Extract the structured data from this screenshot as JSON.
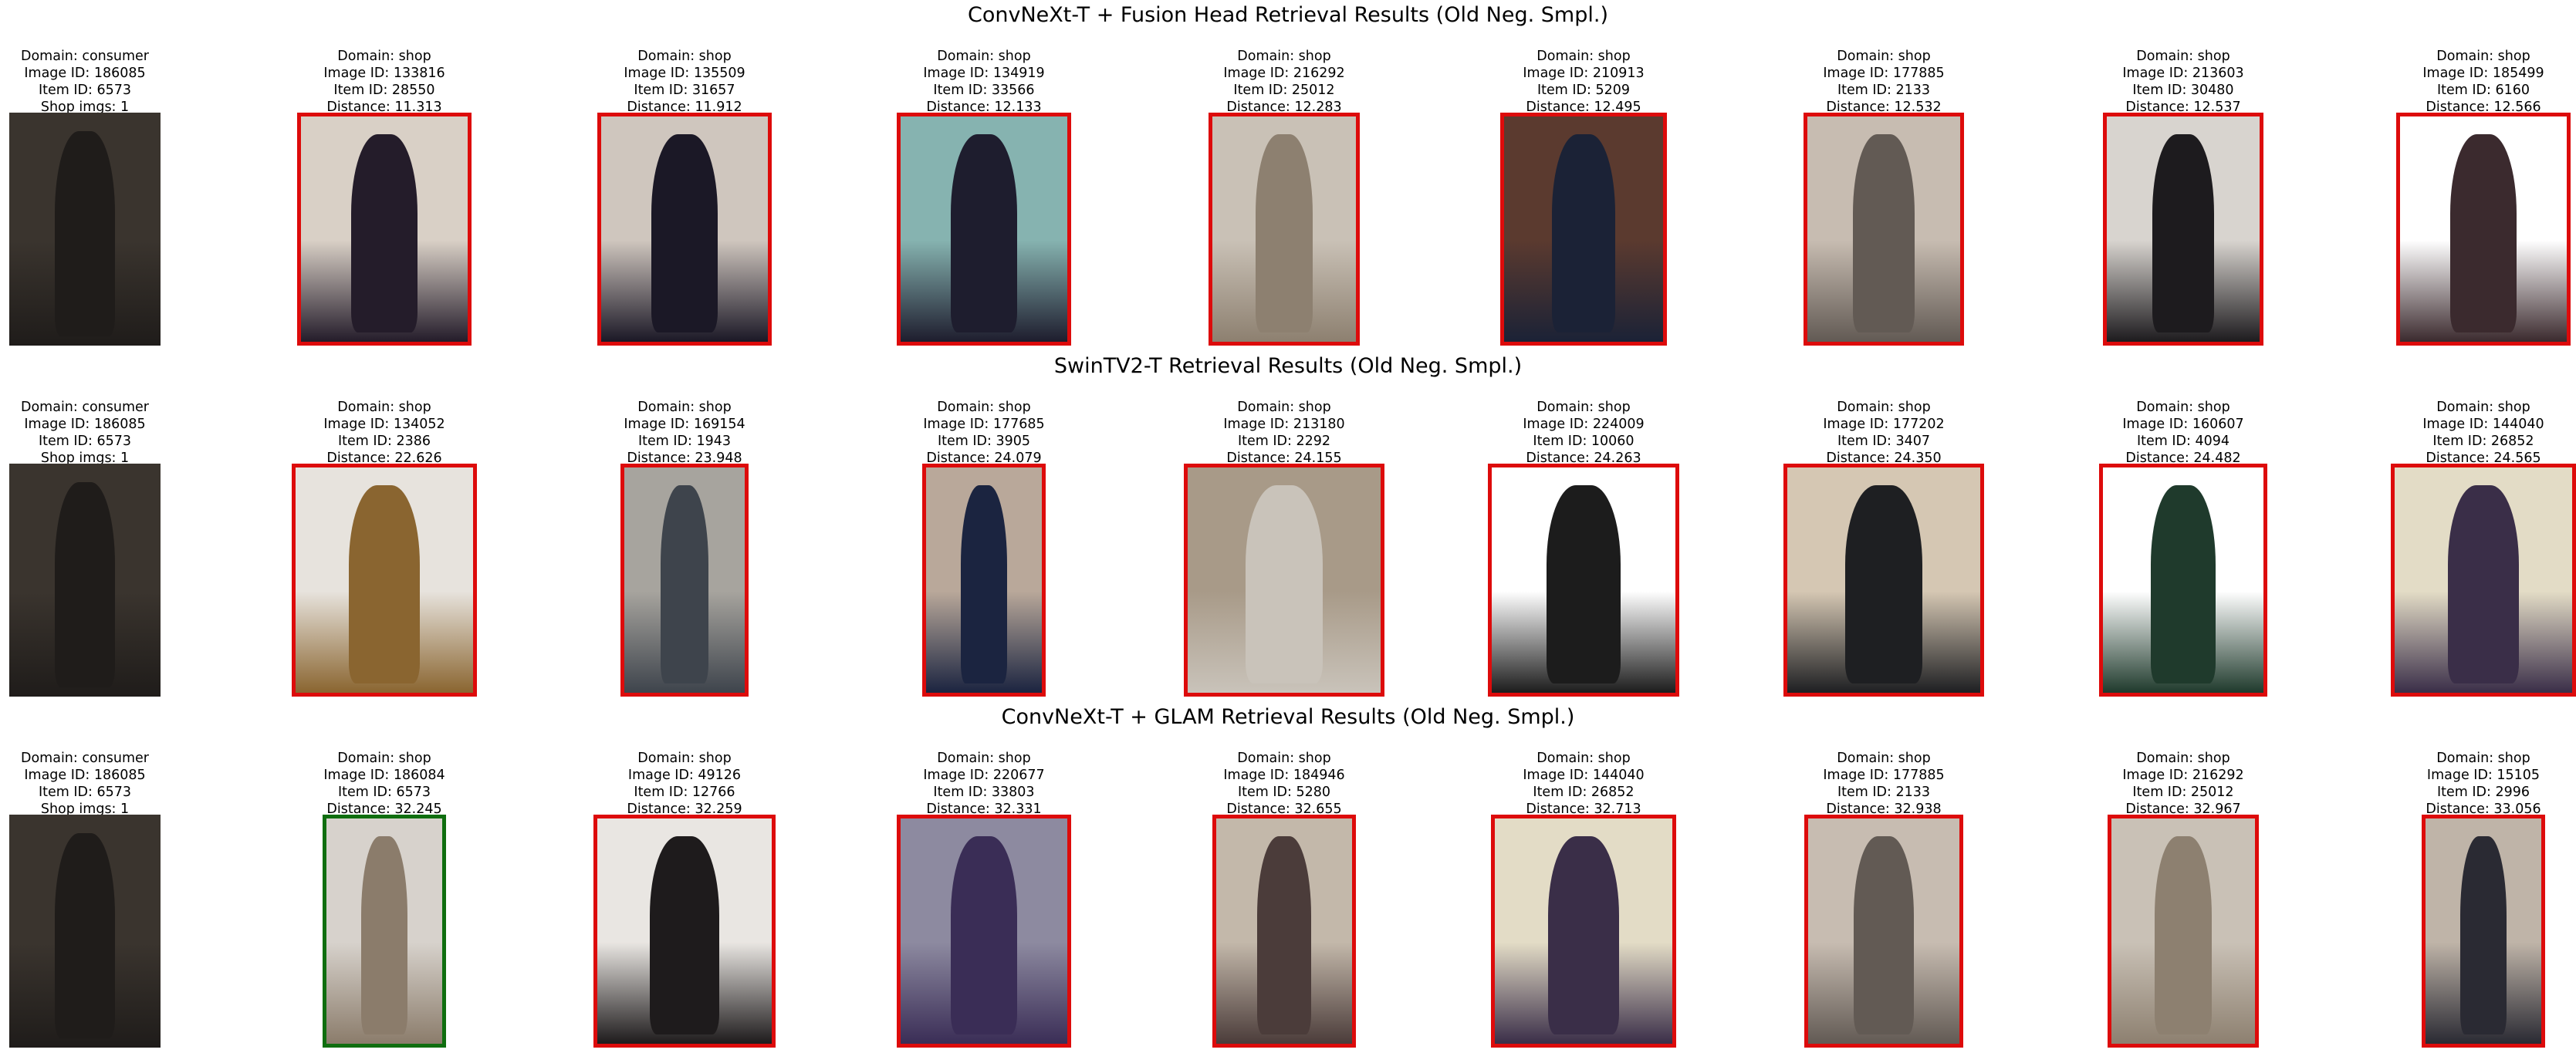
{
  "rows": [
    {
      "title": "ConvNeXt-T + Fusion Head Retrieval Results (Old Neg. Smpl.)",
      "query": {
        "domain": "Domain: consumer",
        "image_id": "Image ID: 186085",
        "item_id": "Item ID: 6573",
        "extra": "Shop imgs: 1",
        "colors": [
          "#3a342e",
          "#1f1c1a"
        ]
      },
      "results": [
        {
          "domain": "Domain: shop",
          "image_id": "Image ID: 133816",
          "item_id": "Item ID: 28550",
          "extra": "Distance: 11.313",
          "match": false,
          "colors": [
            "#d9d0c6",
            "#241c2a"
          ]
        },
        {
          "domain": "Domain: shop",
          "image_id": "Image ID: 135509",
          "item_id": "Item ID: 31657",
          "extra": "Distance: 11.912",
          "match": false,
          "colors": [
            "#cfc6be",
            "#1b1826"
          ]
        },
        {
          "domain": "Domain: shop",
          "image_id": "Image ID: 134919",
          "item_id": "Item ID: 33566",
          "extra": "Distance: 12.133",
          "match": false,
          "colors": [
            "#86b3b0",
            "#1e1d2e"
          ]
        },
        {
          "domain": "Domain: shop",
          "image_id": "Image ID: 216292",
          "item_id": "Item ID: 25012",
          "extra": "Distance: 12.283",
          "match": false,
          "colors": [
            "#c9c1b6",
            "#8d8070"
          ]
        },
        {
          "domain": "Domain: shop",
          "image_id": "Image ID: 210913",
          "item_id": "Item ID: 5209",
          "extra": "Distance: 12.495",
          "match": false,
          "colors": [
            "#5b3a2f",
            "#1b2236"
          ]
        },
        {
          "domain": "Domain: shop",
          "image_id": "Image ID: 177885",
          "item_id": "Item ID: 2133",
          "extra": "Distance: 12.532",
          "match": false,
          "colors": [
            "#c7bcb1",
            "#625a54"
          ]
        },
        {
          "domain": "Domain: shop",
          "image_id": "Image ID: 213603",
          "item_id": "Item ID: 30480",
          "extra": "Distance: 12.537",
          "match": false,
          "colors": [
            "#d8d4cf",
            "#1d1b1e"
          ]
        },
        {
          "domain": "Domain: shop",
          "image_id": "Image ID: 185499",
          "item_id": "Item ID: 6160",
          "extra": "Distance: 12.566",
          "match": false,
          "colors": [
            "#ffffff",
            "#3b2a2e"
          ]
        }
      ]
    },
    {
      "title": "SwinTV2-T Retrieval Results (Old Neg. Smpl.)",
      "query": {
        "domain": "Domain: consumer",
        "image_id": "Image ID: 186085",
        "item_id": "Item ID: 6573",
        "extra": "Shop imgs: 1",
        "colors": [
          "#3a342e",
          "#1f1c1a"
        ]
      },
      "results": [
        {
          "domain": "Domain: shop",
          "image_id": "Image ID: 134052",
          "item_id": "Item ID: 2386",
          "extra": "Distance: 22.626",
          "match": false,
          "colors": [
            "#e7e3dd",
            "#8a6530"
          ]
        },
        {
          "domain": "Domain: shop",
          "image_id": "Image ID: 169154",
          "item_id": "Item ID: 1943",
          "extra": "Distance: 23.948",
          "match": false,
          "colors": [
            "#a7a49e",
            "#3e444c"
          ]
        },
        {
          "domain": "Domain: shop",
          "image_id": "Image ID: 177685",
          "item_id": "Item ID: 3905",
          "extra": "Distance: 24.079",
          "match": false,
          "colors": [
            "#b9a89a",
            "#1b2440"
          ]
        },
        {
          "domain": "Domain: shop",
          "image_id": "Image ID: 213180",
          "item_id": "Item ID: 2292",
          "extra": "Distance: 24.155",
          "match": false,
          "colors": [
            "#a89a88",
            "#c9c3ba"
          ]
        },
        {
          "domain": "Domain: shop",
          "image_id": "Image ID: 224009",
          "item_id": "Item ID: 10060",
          "extra": "Distance: 24.263",
          "match": false,
          "colors": [
            "#ffffff",
            "#1c1c1c"
          ]
        },
        {
          "domain": "Domain: shop",
          "image_id": "Image ID: 177202",
          "item_id": "Item ID: 3407",
          "extra": "Distance: 24.350",
          "match": false,
          "colors": [
            "#d5c7b3",
            "#1e1f22"
          ]
        },
        {
          "domain": "Domain: shop",
          "image_id": "Image ID: 160607",
          "item_id": "Item ID: 4094",
          "extra": "Distance: 24.482",
          "match": false,
          "colors": [
            "#ffffff",
            "#1f3a2c"
          ]
        },
        {
          "domain": "Domain: shop",
          "image_id": "Image ID: 144040",
          "item_id": "Item ID: 26852",
          "extra": "Distance: 24.565",
          "match": false,
          "colors": [
            "#e3dcc6",
            "#3a2e48"
          ]
        }
      ]
    },
    {
      "title": "ConvNeXt-T + GLAM Retrieval Results (Old Neg. Smpl.)",
      "query": {
        "domain": "Domain: consumer",
        "image_id": "Image ID: 186085",
        "item_id": "Item ID: 6573",
        "extra": "Shop imgs: 1",
        "colors": [
          "#3a342e",
          "#1f1c1a"
        ]
      },
      "results": [
        {
          "domain": "Domain: shop",
          "image_id": "Image ID: 186084",
          "item_id": "Item ID: 6573",
          "extra": "Distance: 32.245",
          "match": true,
          "colors": [
            "#d7d2cc",
            "#8b7c6b"
          ]
        },
        {
          "domain": "Domain: shop",
          "image_id": "Image ID: 49126",
          "item_id": "Item ID: 12766",
          "extra": "Distance: 32.259",
          "match": false,
          "colors": [
            "#e9e6e2",
            "#1e1b1c"
          ]
        },
        {
          "domain": "Domain: shop",
          "image_id": "Image ID: 220677",
          "item_id": "Item ID: 33803",
          "extra": "Distance: 32.331",
          "match": false,
          "colors": [
            "#8d8aa0",
            "#3a2d56"
          ]
        },
        {
          "domain": "Domain: shop",
          "image_id": "Image ID: 184946",
          "item_id": "Item ID: 5280",
          "extra": "Distance: 32.655",
          "match": false,
          "colors": [
            "#c3b8aa",
            "#4b3c3a"
          ]
        },
        {
          "domain": "Domain: shop",
          "image_id": "Image ID: 144040",
          "item_id": "Item ID: 26852",
          "extra": "Distance: 32.713",
          "match": false,
          "colors": [
            "#e3dcc6",
            "#3a2e48"
          ]
        },
        {
          "domain": "Domain: shop",
          "image_id": "Image ID: 177885",
          "item_id": "Item ID: 2133",
          "extra": "Distance: 32.938",
          "match": false,
          "colors": [
            "#c7bcb1",
            "#625a54"
          ]
        },
        {
          "domain": "Domain: shop",
          "image_id": "Image ID: 216292",
          "item_id": "Item ID: 25012",
          "extra": "Distance: 32.967",
          "match": false,
          "colors": [
            "#c9c1b6",
            "#8d8070"
          ]
        },
        {
          "domain": "Domain: shop",
          "image_id": "Image ID: 15105",
          "item_id": "Item ID: 2996",
          "extra": "Distance: 33.056",
          "match": false,
          "colors": [
            "#bfb4a8",
            "#2a2a33"
          ]
        }
      ]
    }
  ]
}
